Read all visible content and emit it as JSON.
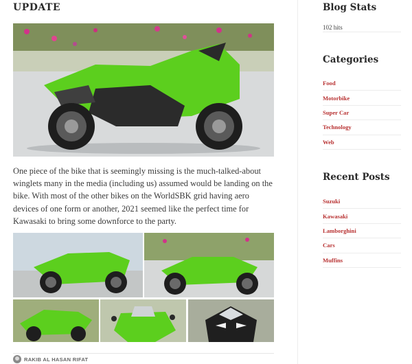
{
  "post": {
    "title": "UPDATE",
    "excerpt": "One piece of the bike that is seemingly missing is the much-talked-about winglets many in the media (including us) assumed would be landing on the bike. With most of the other bikes on the WorldSBK grid having aero devices of one form or another, 2021 seemed like the perfect time for Kawasaki to bring some downforce to the party.",
    "author": "RAKIB AL HASAN RIFAT"
  },
  "sidebar": {
    "stats": {
      "title": "Blog Stats",
      "value": "102 hits"
    },
    "categories": {
      "title": "Categories",
      "items": [
        "Food",
        "Motorbike",
        "Super Car",
        "Technology",
        "Web"
      ]
    },
    "recent": {
      "title": "Recent Posts",
      "items": [
        "Suzuki",
        "Kawasaki",
        "Lamborghini",
        "Cars",
        "Muffins"
      ]
    }
  },
  "colors": {
    "link": "#b83232",
    "bike_green": "#5ccf1e"
  }
}
